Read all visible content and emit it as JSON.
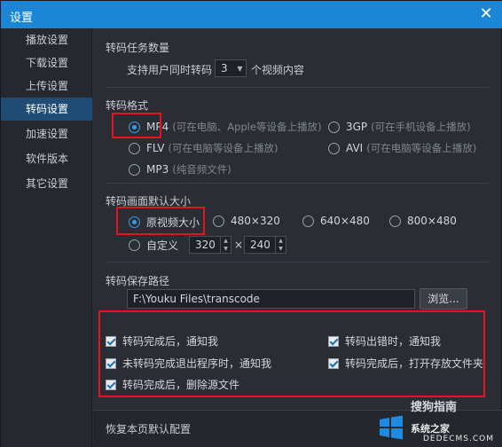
{
  "window": {
    "title": "设置"
  },
  "sidebar": {
    "items": [
      {
        "label": "播放设置"
      },
      {
        "label": "下载设置"
      },
      {
        "label": "上传设置"
      },
      {
        "label": "转码设置"
      },
      {
        "label": "加速设置"
      },
      {
        "label": "软件版本"
      },
      {
        "label": "其它设置"
      }
    ],
    "active_index": 3
  },
  "tasks": {
    "title": "转码任务数量",
    "prefix": "支持用户同时转码",
    "value": "3",
    "suffix": "个视频内容"
  },
  "format": {
    "title": "转码格式",
    "options": [
      {
        "label": "MP4",
        "hint": "(可在电脑、Apple等设备上播放)",
        "selected": true
      },
      {
        "label": "3GP",
        "hint": "(可在手机设备上播放)",
        "selected": false
      },
      {
        "label": "FLV",
        "hint": "(可在电脑等设备上播放)",
        "selected": false
      },
      {
        "label": "AVI",
        "hint": "(可在电脑等设备上播放)",
        "selected": false
      },
      {
        "label": "MP3",
        "hint": "(纯音频文件)",
        "selected": false
      }
    ]
  },
  "size": {
    "title": "转码画面默认大小",
    "options": [
      {
        "label": "原视频大小",
        "selected": true
      },
      {
        "label": "480×320",
        "selected": false
      },
      {
        "label": "640×480",
        "selected": false
      },
      {
        "label": "800×480",
        "selected": false
      }
    ],
    "custom": {
      "label": "自定义",
      "width": "320",
      "times": "×",
      "height": "240"
    }
  },
  "path": {
    "title": "转码保存路径",
    "value": "F:\\Youku Files\\transcode",
    "browse_label": "浏览..."
  },
  "notify": {
    "items": [
      {
        "label": "转码完成后，通知我",
        "checked": true
      },
      {
        "label": "转码出错时，通知我",
        "checked": true
      },
      {
        "label": "未转码完成退出程序时，通知我",
        "checked": true
      },
      {
        "label": "转码完成后，打开存放文件夹",
        "checked": true
      },
      {
        "label": "转码完成后，删除源文件",
        "checked": true
      }
    ]
  },
  "footer": {
    "restore_label": "恢复本页默认配置"
  },
  "watermark": {
    "line1": "搜狗指南",
    "line2": "系统之家",
    "line3": "DEDECMS.COM"
  },
  "colors": {
    "titlebar": "#1b86d6",
    "accent": "#3a9be8",
    "highlight_box": "#e0161a",
    "active_sidebar": "#1f4c74"
  }
}
